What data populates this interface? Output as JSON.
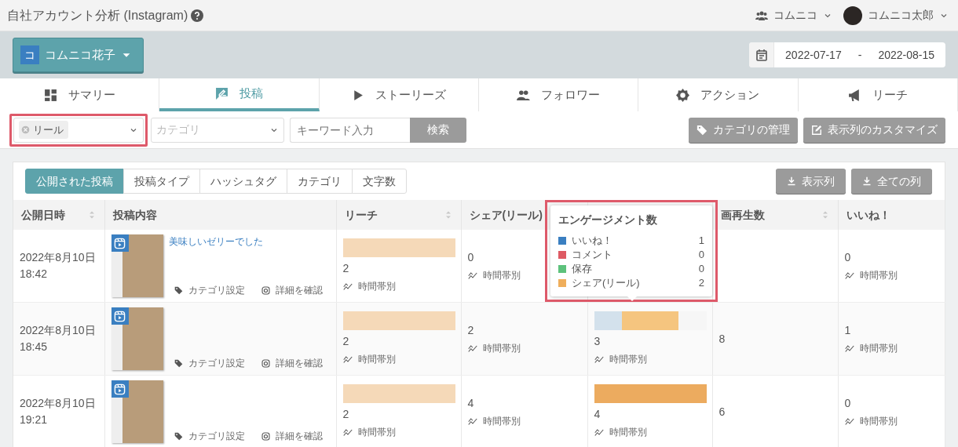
{
  "header": {
    "title": "自社アカウント分析 (Instagram)",
    "organization": "コムニコ",
    "user": "コムニコ太郎"
  },
  "account": {
    "initial": "コ",
    "name": "コムニコ花子"
  },
  "date_range": {
    "start": "2022-07-17",
    "separator": "-",
    "end": "2022-08-15"
  },
  "tabs": [
    {
      "label": "サマリー",
      "selected": false
    },
    {
      "label": "投稿",
      "selected": true
    },
    {
      "label": "ストーリーズ",
      "selected": false
    },
    {
      "label": "フォロワー",
      "selected": false
    },
    {
      "label": "アクション",
      "selected": false
    },
    {
      "label": "リーチ",
      "selected": false
    }
  ],
  "filters": {
    "type_chip": "リール",
    "highlighted": true,
    "category_placeholder": "カテゴリ",
    "keyword_placeholder": "キーワード入力",
    "search_button": "検索",
    "buttons": [
      "カテゴリの管理",
      "表示列のカスタマイズ"
    ]
  },
  "subtabs": [
    {
      "label": "公開された投稿",
      "selected": true
    },
    {
      "label": "投稿タイプ",
      "selected": false
    },
    {
      "label": "ハッシュタグ",
      "selected": false
    },
    {
      "label": "カテゴリ",
      "selected": false
    },
    {
      "label": "文字数",
      "selected": false
    }
  ],
  "export_buttons": [
    "表示列",
    "全ての列"
  ],
  "table": {
    "columns": [
      {
        "label": "公開日時",
        "sortable": true
      },
      {
        "label": "投稿内容",
        "sortable": false
      },
      {
        "label": "リーチ",
        "sortable": true
      },
      {
        "label": "シェア(リール)",
        "sortable": false
      },
      {
        "label": "画再生数",
        "sortable": true
      },
      {
        "label": "いいね！",
        "sortable": false
      }
    ],
    "rows": [
      {
        "date": "2022年8月10日",
        "time": "18:42",
        "caption": "美味しいゼリーでした",
        "category_link": "カテゴリ設定",
        "detail_link": "詳細を確認",
        "reach": {
          "bar": [
            {
              "level": 1,
              "color": "#f5d9b8"
            }
          ],
          "value": "2",
          "link": "時間帯別"
        },
        "share": {
          "value": "0",
          "link": "時間帯別"
        },
        "likes": {
          "value": "0",
          "link": "時間帯別"
        }
      },
      {
        "date": "2022年8月10日",
        "time": "18:45",
        "category_link": "カテゴリ設定",
        "detail_link": "詳細を確認",
        "reach": {
          "bar": [
            {
              "level": 1,
              "color": "#f5d9b8"
            }
          ],
          "value": "2",
          "link": "時間帯別"
        },
        "share": {
          "value": "2",
          "link": "時間帯別"
        },
        "engagement": {
          "bar": [
            {
              "level": 0.25,
              "color": "#d3e1ec"
            },
            {
              "level": 0.75,
              "color": "#f5c57f"
            }
          ],
          "value": "3",
          "link": "時間帯別"
        },
        "plays": {
          "value": "8"
        },
        "likes": {
          "value": "1",
          "link": "時間帯別"
        }
      },
      {
        "date": "2022年8月10日",
        "time": "19:21",
        "category_link": "カテゴリ設定",
        "detail_link": "詳細を確認",
        "reach": {
          "bar": [
            {
              "level": 1,
              "color": "#f5d9b8"
            }
          ],
          "value": "2",
          "link": "時間帯別"
        },
        "share": {
          "value": "4",
          "link": "時間帯別"
        },
        "engagement": {
          "bar": [
            {
              "level": 1,
              "color": "#ecab5f"
            }
          ],
          "value": "4",
          "link": "時間帯別"
        },
        "plays": {
          "value": "6"
        },
        "likes": {
          "value": "0",
          "link": "時間帯別"
        }
      }
    ]
  },
  "tooltip": {
    "title": "エンゲージメント数",
    "highlighted": true,
    "items": [
      {
        "label": "いいね！",
        "value": "1",
        "color": "#3a7fc1"
      },
      {
        "label": "コメント",
        "value": "0",
        "color": "#de5a63"
      },
      {
        "label": "保存",
        "value": "0",
        "color": "#5dc27c"
      },
      {
        "label": "シェア(リール)",
        "value": "2",
        "color": "#efae5c"
      }
    ]
  }
}
